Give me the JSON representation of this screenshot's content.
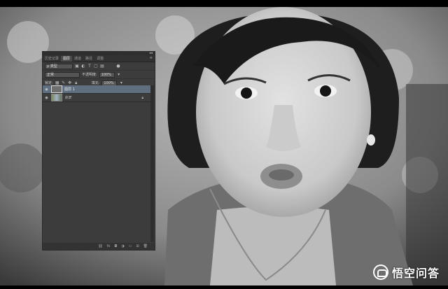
{
  "panel": {
    "tabs": [
      {
        "label": "历史记录"
      },
      {
        "label": "图层"
      },
      {
        "label": "通道"
      },
      {
        "label": "路径"
      },
      {
        "label": "调整"
      }
    ],
    "kind_label": "ρ 类型",
    "blend_mode": "正常",
    "opacity_label": "不透明度:",
    "opacity_value": "100%",
    "lock_label": "锁定:",
    "fill_label": "填充:",
    "fill_value": "100%",
    "layers": [
      {
        "name": "图层 1",
        "selected": true
      },
      {
        "name": "背景",
        "selected": false
      }
    ]
  },
  "watermark": {
    "text": "悟空问答"
  }
}
